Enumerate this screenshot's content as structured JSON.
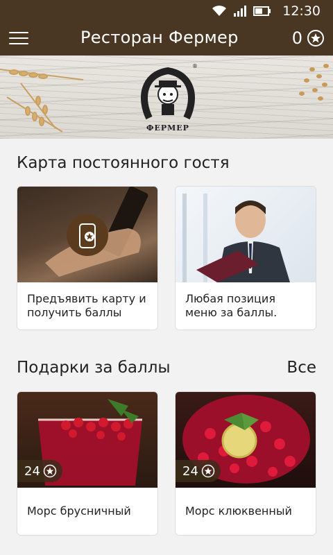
{
  "status_bar": {
    "time": "12:30"
  },
  "app_bar": {
    "title": "Ресторан Фермер",
    "points": "0"
  },
  "banner": {
    "logo_text": "ФЕРМЕР"
  },
  "loyalty": {
    "title": "Карта постоянного гостя",
    "cards": [
      {
        "line1": "Предъявить карту и",
        "line2": "получить баллы"
      },
      {
        "line1": "Любая позиция",
        "line2": "меню за баллы."
      }
    ]
  },
  "gifts": {
    "title": "Подарки за баллы",
    "see_all": "Все",
    "items": [
      {
        "name": "Морс брусничный",
        "price": "24"
      },
      {
        "name": "Морс клюквенный",
        "price": "24"
      }
    ]
  },
  "colors": {
    "brand": "#4a3723",
    "accent": "#6b4a2b"
  }
}
